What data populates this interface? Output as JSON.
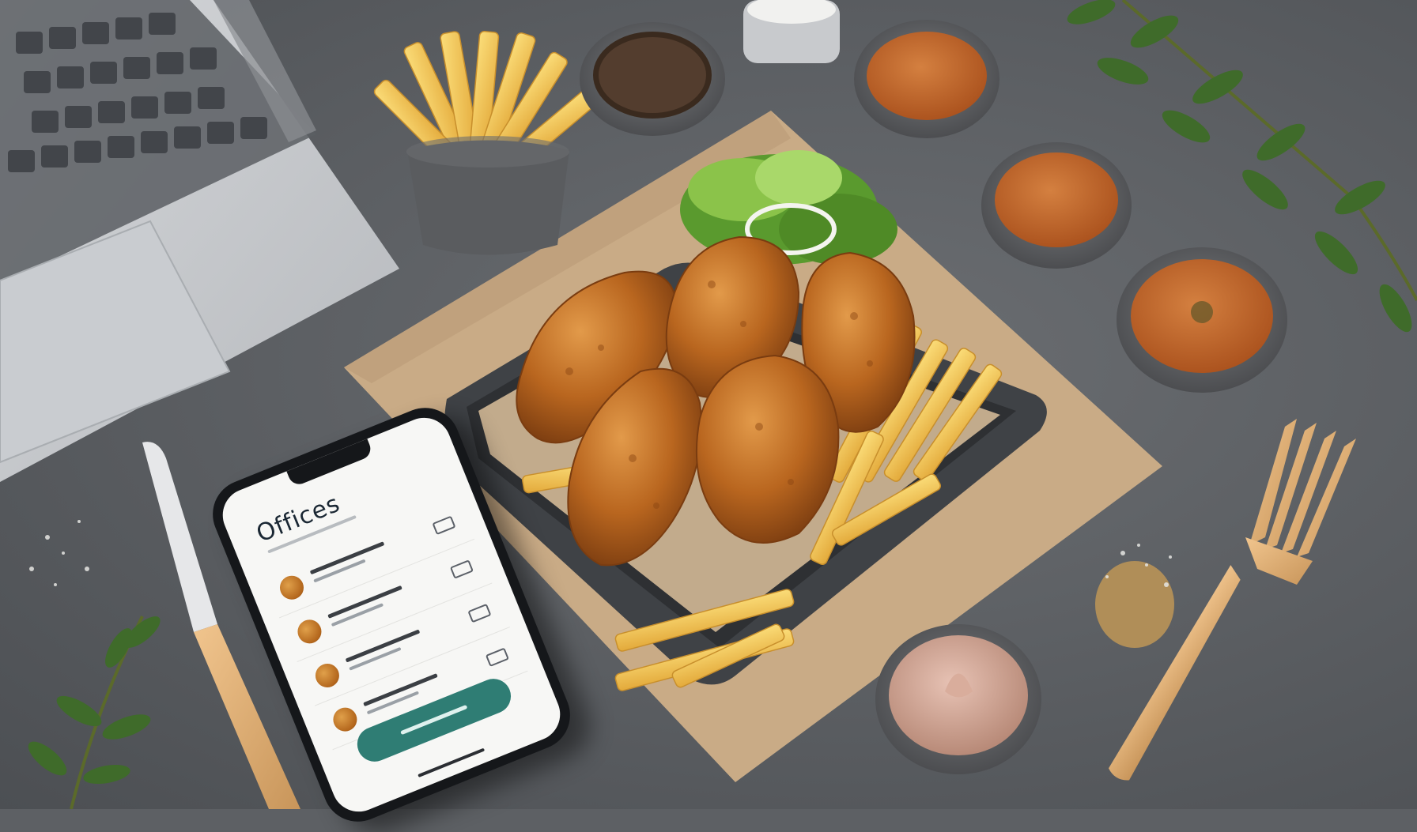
{
  "scene": {
    "description_colors": {
      "countertop": "#5d6064",
      "paper": "#c9ab86",
      "chicken": "#b3661c",
      "fries": "#f2c24a",
      "sauce": "#c2672a",
      "app_accent": "#2f7d74"
    }
  },
  "phone": {
    "app_title": "Offices",
    "list_items_count": 4
  }
}
